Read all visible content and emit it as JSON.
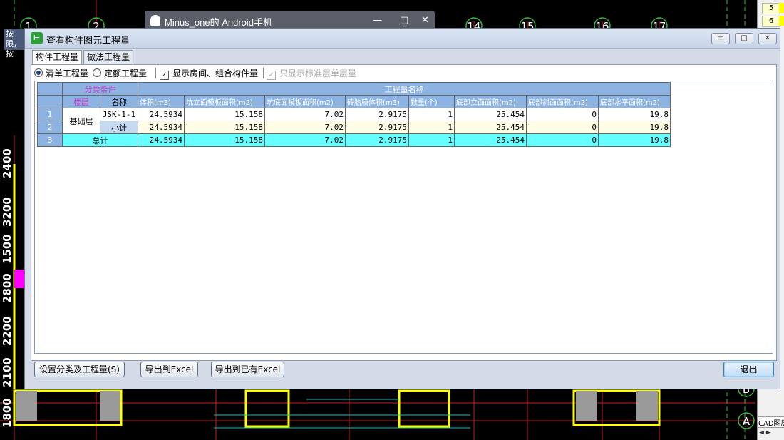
{
  "background": {
    "left_stub": "按限，按",
    "mini_window": {
      "title": "Minus_one的 Android手机"
    },
    "axis_numbers_top": [
      "1",
      "2",
      "14",
      "15",
      "16",
      "17"
    ],
    "ruler_left": [
      "2400",
      "3200",
      "1500",
      "2800",
      "2200",
      "2100",
      "1800"
    ],
    "right_panel": {
      "cells": [
        "5",
        "6"
      ],
      "cad_label": "CAD图层"
    },
    "axis_letters": [
      "B",
      "A"
    ]
  },
  "dialog": {
    "title": "查看构件图元工程量",
    "tabs": [
      "构件工程量",
      "做法工程量"
    ],
    "options": {
      "radio_qingdan": "清单工程量",
      "radio_dinge": "定额工程量",
      "chk_room": "显示房间、组合构件量",
      "chk_std": "只显示标准层单层量"
    },
    "table": {
      "group_header_left": "分类条件",
      "group_header_right": "工程量名称",
      "col_level": "楼层",
      "col_name": "名称",
      "columns": [
        "体积(m3)",
        "坑立面模板面积(m2)",
        "坑底面模板面积(m2)",
        "砖胎膜体积(m3)",
        "数量(个)",
        "底部立面面积(m2)",
        "底部斜面面积(m2)",
        "底部水平面积(m2)"
      ],
      "rows": [
        {
          "num": "1",
          "level": "基础层",
          "name": "JSK-1-1",
          "values": [
            "24.5934",
            "15.158",
            "7.02",
            "2.9175",
            "1",
            "25.454",
            "0",
            "19.8"
          ]
        },
        {
          "num": "2",
          "name": "小计",
          "values": [
            "24.5934",
            "15.158",
            "7.02",
            "2.9175",
            "1",
            "25.454",
            "0",
            "19.8"
          ]
        }
      ],
      "total": {
        "num": "3",
        "label": "总计",
        "values": [
          "24.5934",
          "15.158",
          "7.02",
          "2.9175",
          "1",
          "25.454",
          "0",
          "19.8"
        ]
      }
    },
    "buttons": {
      "settings": "设置分类及工程量(S)",
      "export_excel": "导出到Excel",
      "export_existing": "导出到已有Excel",
      "exit": "退出"
    },
    "colors": {
      "header": "#8db3e2",
      "total_row": "#66ffff",
      "subtotal_name": "#c5d9f1",
      "pink_text": "#c83ec8"
    }
  }
}
